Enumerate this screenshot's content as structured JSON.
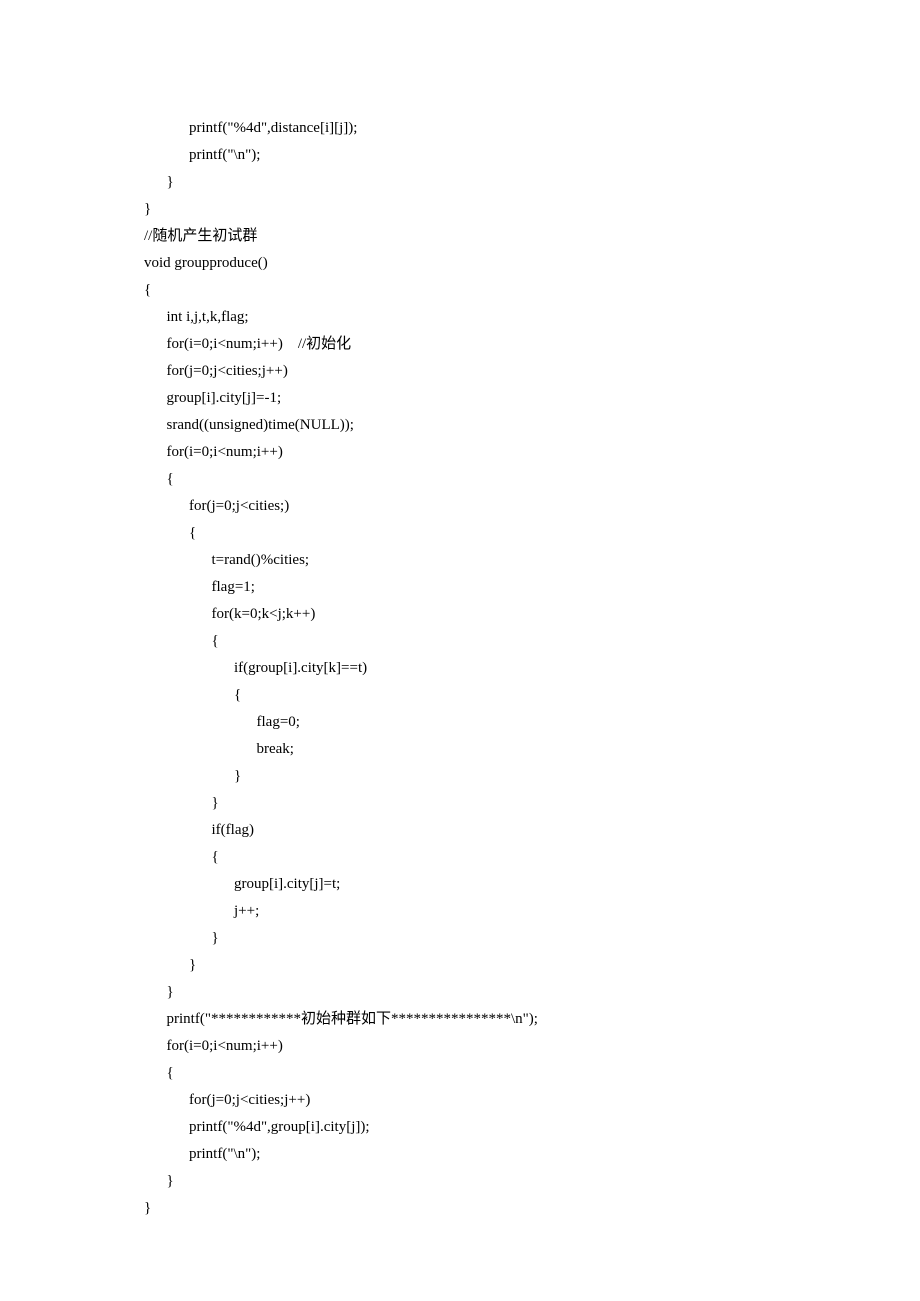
{
  "lines": [
    "            printf(\"%4d\",distance[i][j]);",
    "            printf(\"\\n\");",
    "      }",
    "}",
    "",
    "//随机产生初试群",
    "void groupproduce()",
    "{",
    "      int i,j,t,k,flag;",
    "      for(i=0;i<num;i++)    //初始化",
    "      for(j=0;j<cities;j++)",
    "      group[i].city[j]=-1;",
    "      srand((unsigned)time(NULL));",
    "      for(i=0;i<num;i++)",
    "      {",
    "",
    "            for(j=0;j<cities;)",
    "            {",
    "                  t=rand()%cities;",
    "                  flag=1;",
    "                  for(k=0;k<j;k++)",
    "                  {",
    "                        if(group[i].city[k]==t)",
    "                        {",
    "                              flag=0;",
    "                              break;",
    "                        }",
    "                  }",
    "                  if(flag)",
    "                  {",
    "                        group[i].city[j]=t;",
    "                        j++;",
    "                  }",
    "            }",
    "      }",
    "",
    "      printf(\"************初始种群如下****************\\n\");",
    "      for(i=0;i<num;i++)",
    "      {",
    "            for(j=0;j<cities;j++)",
    "            printf(\"%4d\",group[i].city[j]);",
    "            printf(\"\\n\");",
    "      }",
    "}"
  ]
}
